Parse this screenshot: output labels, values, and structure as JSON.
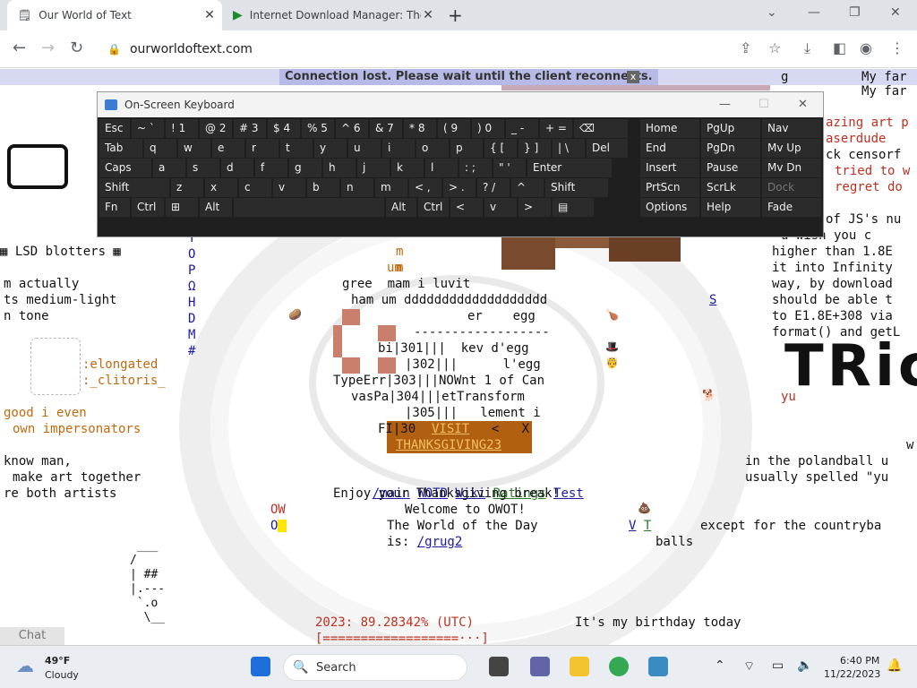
{
  "browser": {
    "tabs": [
      {
        "title": "Our World of Text",
        "close": "✕"
      },
      {
        "title": "Internet Download Manager: The",
        "close": "✕"
      }
    ],
    "new_tab": "+",
    "window_controls": {
      "dropdown": "⌄",
      "minimize": "—",
      "restore": "❐",
      "close": "✕"
    },
    "url": "ourworldoftext.com"
  },
  "page": {
    "banner": "Connection lost. Please wait until the client reconnects.",
    "banner_close": "x",
    "left": {
      "lsd": "▦ LSD blotters ▦",
      "actually": "m actually",
      "medium": "ts medium-light",
      "tone": "n tone",
      "elongated": ":elongated",
      "clitoris": ":_clitoris_",
      "good": "good i even",
      "impersonators": "own impersonators",
      "know": "know man,",
      "make_art": "make art together",
      "both": "re both artists",
      "ascii_art": " ___\n/\n| ##\n|.---\n `.o\n  \\__"
    },
    "right": {
      "my_far1": "My far",
      "my_far2": "My far",
      "zazing": "azing art p",
      "laser": "aserdude",
      "ck": "ck censorf",
      "tried": "tried to w",
      "regret": "regret do",
      "js": "of JS's nu",
      "wish": "u wish you c",
      "higher": "higher than 1.8E",
      "infinity": "it into Infinity",
      "download": "way, by download",
      "able": "should be able t",
      "to_e": "to E1.8E+308 via",
      "format": "format() and getL",
      "tric": "TRic",
      "yu": "yu",
      "w": "w",
      "polandball": "in the polandball u",
      "spelled": "usually spelled \"yu",
      "countryba": "except for the countryba",
      "balls": "balls",
      "g": "g",
      "birthday": "It's my birthday today"
    },
    "center": {
      "m1": "m",
      "m2": "m",
      "um": "um",
      "gree": "gree  mam i luvit",
      "ham": "ham um ddddddddddddddddddd",
      "er_egg": "er    egg",
      "dashes": "------------------",
      "bi": "bi|301|||  kev d'egg",
      "l_egg": "|302|||      l'egg",
      "typeerr": "TypeErr|303|||NOWnt 1 of Can",
      "vaspa": "vasPa|304|||etTransform",
      "lement": "|305|||   lement i",
      "fi": "FI|30",
      "visit": "VISIT",
      "lt_x": "  <   X",
      "thanksgiving": "THANKSGIVING23",
      "links": [
        {
          "label": "/main",
          "kind": "link"
        },
        {
          "label": "WOTD",
          "kind": "link"
        },
        {
          "label": "Wiki",
          "kind": "link"
        },
        {
          "label": "Ratings",
          "kind": "glink"
        },
        {
          "label": "Test",
          "kind": "link"
        }
      ],
      "enjoy": "Enjoy your Thanksgiving break!",
      "welcome": "Welcome to OWOT!",
      "wotd1": "The World of the Day",
      "wotd2_prefix": "is: ",
      "wotd2_link": "/grug2",
      "ow": "OW",
      "o": "O",
      "vt_v": "V",
      "vt_t": "T",
      "year": "2023: 89.28342% (UTC)",
      "progress": "[==================···]",
      "left_col": "T\nO\nP\nΩ\nH\nD\nM\n#",
      "right_s": "S"
    },
    "chat_button": "Chat"
  },
  "osk": {
    "title": "On-Screen Keyboard",
    "controls": {
      "minimize": "—",
      "maximize": "☐",
      "close": "✕"
    },
    "rows": [
      [
        "Esc",
        "~ `",
        "! 1",
        "@ 2",
        "# 3",
        "$ 4",
        "% 5",
        "^ 6",
        "& 7",
        "* 8",
        "( 9",
        ") 0",
        "_ -",
        "+ =",
        "⌫"
      ],
      [
        "Tab",
        "q",
        "w",
        "e",
        "r",
        "t",
        "y",
        "u",
        "i",
        "o",
        "p",
        "{ [",
        "} ]",
        "| \\",
        "Del"
      ],
      [
        "Caps",
        "a",
        "s",
        "d",
        "f",
        "g",
        "h",
        "j",
        "k",
        "l",
        ": ;",
        "\" '",
        "Enter"
      ],
      [
        "Shift",
        "z",
        "x",
        "c",
        "v",
        "b",
        "n",
        "m",
        "< ,",
        "> .",
        "? /",
        "^",
        "Shift"
      ],
      [
        "Fn",
        "Ctrl",
        "⊞",
        "Alt",
        "",
        "Alt",
        "Ctrl",
        "<",
        "v",
        ">",
        "▤"
      ]
    ],
    "nav_rows": [
      [
        "Home",
        "PgUp",
        "Nav"
      ],
      [
        "End",
        "PgDn",
        "Mv Up"
      ],
      [
        "Insert",
        "Pause",
        "Mv Dn"
      ],
      [
        "PrtScn",
        "ScrLk",
        "Dock"
      ],
      [
        "Options",
        "Help",
        "Fade"
      ]
    ]
  },
  "taskbar": {
    "weather_temp": "49°F",
    "weather_desc": "Cloudy",
    "search": "Search",
    "time": "6:40 PM",
    "date": "11/22/2023"
  }
}
